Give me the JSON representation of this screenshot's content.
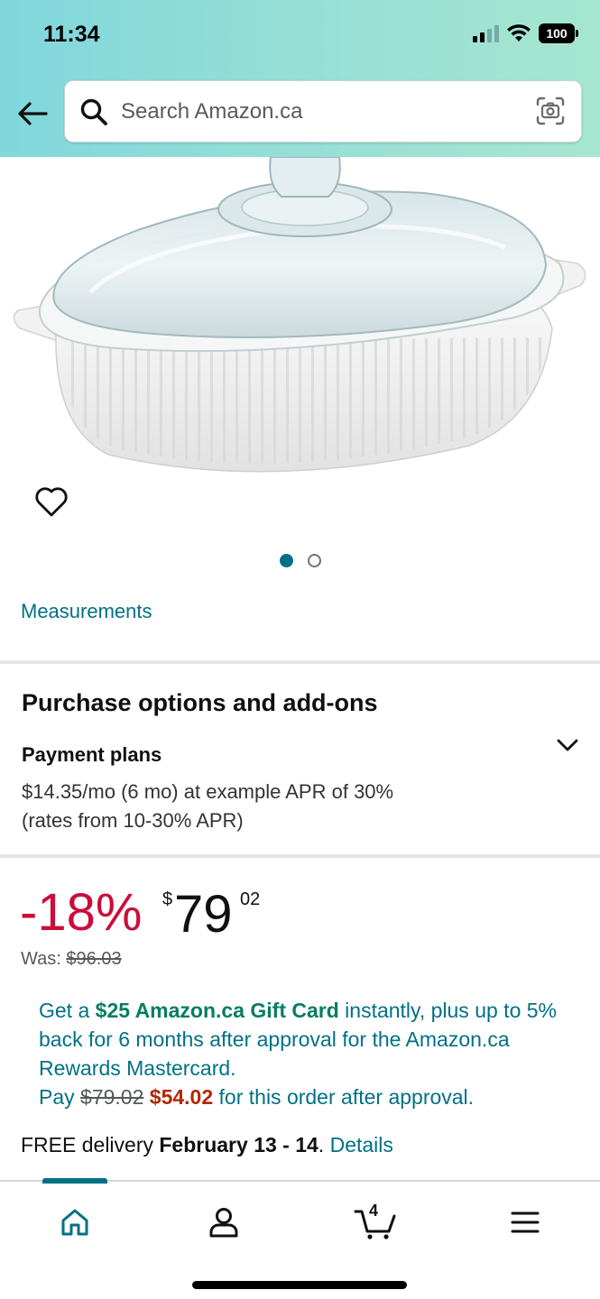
{
  "status_bar": {
    "time": "11:34",
    "battery": "100"
  },
  "search": {
    "placeholder": "Search Amazon.ca"
  },
  "gallery": {
    "total_images": 2,
    "active_index": 0
  },
  "measurements_link": "Measurements",
  "purchase_options": {
    "title": "Purchase options and add-ons",
    "payment_plans_title": "Payment plans",
    "payment_plans_line1": "$14.35/mo (6 mo) at example APR of 30%",
    "payment_plans_line2": "(rates from 10-30% APR)"
  },
  "pricing": {
    "discount": "-18%",
    "currency_symbol": "$",
    "price_whole": "79",
    "price_fraction": "02",
    "was_label": "Was:",
    "was_price": "$96.03"
  },
  "promo": {
    "text1": "Get a ",
    "gift_card": "$25 Amazon.ca Gift Card",
    "text2": " instantly, plus up to 5% back for 6 months after approval for the Amazon.ca Rewards Mastercard.",
    "pay_label": "Pay ",
    "old_price": "$79.02",
    "new_price": "$54.02",
    "text3": " for this order after approval."
  },
  "delivery": {
    "prefix": "FREE delivery ",
    "dates": "February 13 - 14",
    "separator": ". ",
    "details_link": "Details"
  },
  "tabbar": {
    "cart_count": "4"
  },
  "colors": {
    "accent": "#007185",
    "discount": "#cc0c39",
    "promo_green": "#067d62",
    "promo_red": "#b12704"
  }
}
